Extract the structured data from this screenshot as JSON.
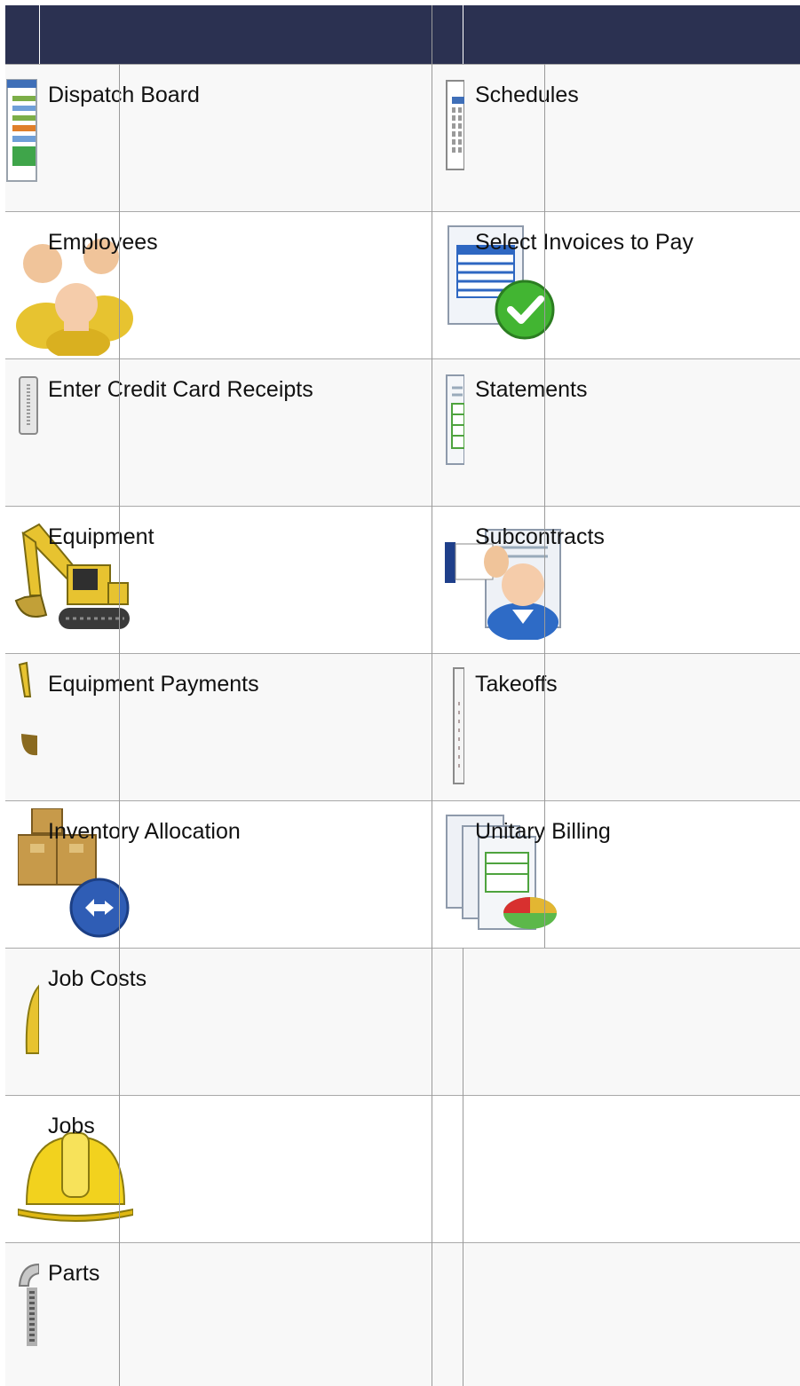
{
  "header": {
    "left_title": "",
    "right_title": ""
  },
  "left_column": [
    {
      "label": "Dispatch Board",
      "icon": "dispatch-board-icon"
    },
    {
      "label": "Employees",
      "icon": "employees-icon"
    },
    {
      "label": "Enter Credit Card Receipts",
      "icon": "credit-card-receipts-icon"
    },
    {
      "label": "Equipment",
      "icon": "excavator-icon"
    },
    {
      "label": "Equipment Payments",
      "icon": "equipment-payments-icon"
    },
    {
      "label": "Inventory Allocation",
      "icon": "inventory-allocation-icon"
    },
    {
      "label": "Job Costs",
      "icon": "job-costs-icon"
    },
    {
      "label": "Jobs",
      "icon": "hard-hat-icon"
    },
    {
      "label": "Parts",
      "icon": "parts-icon"
    }
  ],
  "right_column": [
    {
      "label": "Schedules",
      "icon": "schedules-icon"
    },
    {
      "label": "Select Invoices to Pay",
      "icon": "select-invoices-icon"
    },
    {
      "label": "Statements",
      "icon": "statements-icon"
    },
    {
      "label": "Subcontracts",
      "icon": "subcontracts-icon"
    },
    {
      "label": "Takeoffs",
      "icon": "takeoffs-icon"
    },
    {
      "label": "Unitary Billing",
      "icon": "unitary-billing-icon"
    }
  ],
  "colors": {
    "header_bg": "#2b3151",
    "row_bg": "#f8f8f8",
    "row_alt_bg": "#ffffff",
    "grid_line": "#a9a9a9"
  }
}
